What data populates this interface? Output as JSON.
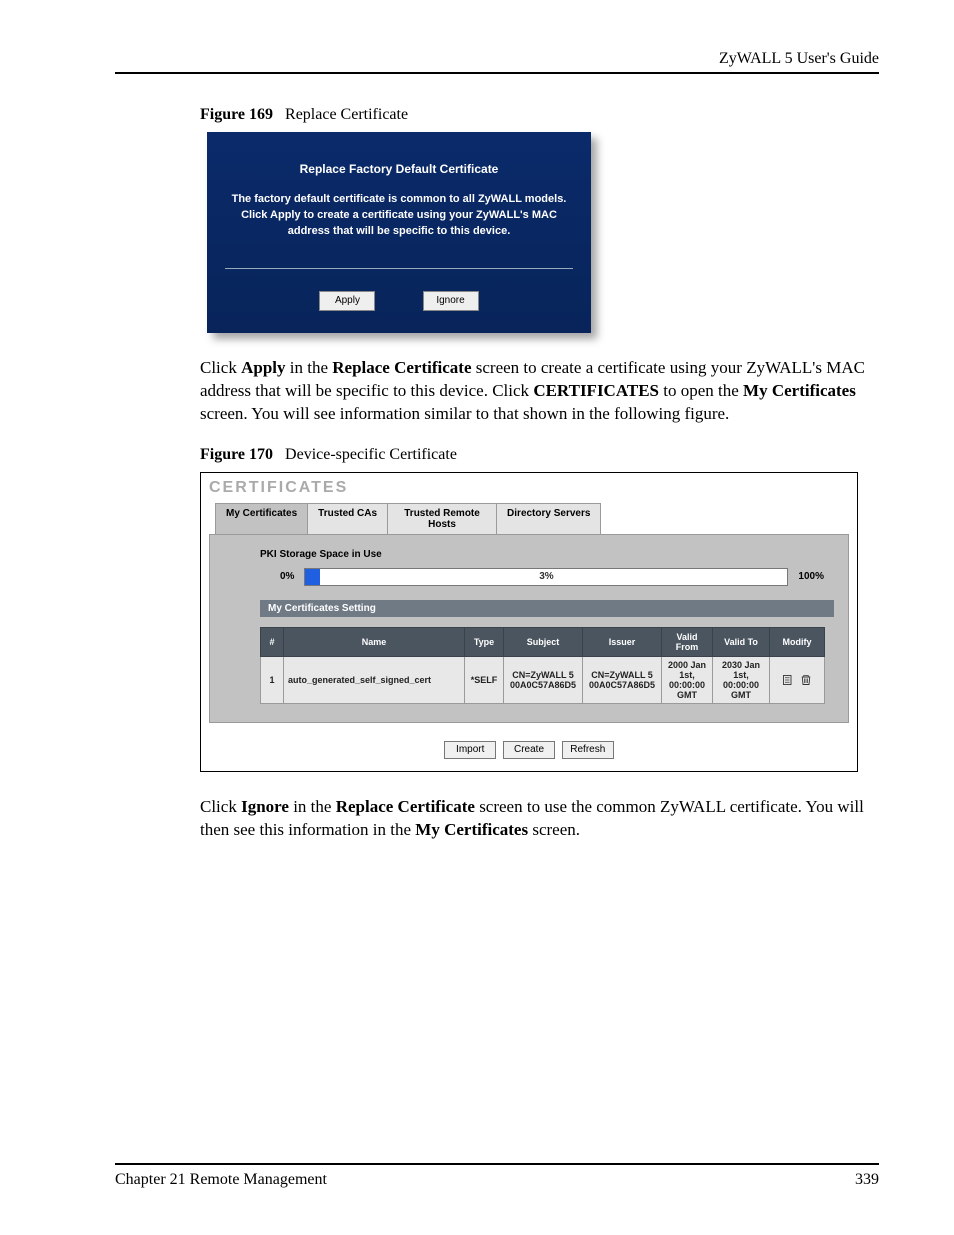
{
  "page_header": "ZyWALL 5 User's Guide",
  "figure169": {
    "label": "Figure 169",
    "title": "Replace Certificate",
    "dialog_title": "Replace Factory Default Certificate",
    "dialog_body": "The factory default certificate is common to all ZyWALL models. Click Apply to create a certificate using your ZyWALL's MAC address that will be specific to this device.",
    "apply_label": "Apply",
    "ignore_label": "Ignore"
  },
  "body_text_1_a": "Click ",
  "body_text_1_apply": "Apply",
  "body_text_1_b": " in the ",
  "body_text_1_replace": "Replace Certificate",
  "body_text_1_c": " screen to create a certificate using your ZyWALL's MAC address that will be specific to this device. Click ",
  "body_text_1_certs": "CERTIFICATES",
  "body_text_1_d": " to open the ",
  "body_text_1_my": "My Certificates",
  "body_text_1_e": " screen. You will see information similar to that shown in the following figure.",
  "figure170": {
    "label": "Figure 170",
    "title": "Device-specific Certificate",
    "screen_heading": "CERTIFICATES",
    "tabs": {
      "t0": "My Certificates",
      "t1": "Trusted CAs",
      "t2": "Trusted Remote Hosts",
      "t3": "Directory Servers"
    },
    "storage_label": "PKI Storage Space in Use",
    "storage_min": "0%",
    "storage_pct": "3%",
    "storage_max": "100%",
    "setting_label": "My Certificates Setting",
    "columns": {
      "num": "#",
      "name": "Name",
      "type": "Type",
      "subject": "Subject",
      "issuer": "Issuer",
      "valid_from": "Valid From",
      "valid_to": "Valid To",
      "modify": "Modify"
    },
    "row": {
      "num": "1",
      "name": "auto_generated_self_signed_cert",
      "type": "*SELF",
      "subject": "CN=ZyWALL 5 00A0C57A86D5",
      "issuer": "CN=ZyWALL 5 00A0C57A86D5",
      "valid_from": "2000 Jan 1st, 00:00:00 GMT",
      "valid_to": "2030 Jan 1st, 00:00:00 GMT"
    },
    "buttons": {
      "import": "Import",
      "create": "Create",
      "refresh": "Refresh"
    }
  },
  "body_text_2_a": "Click ",
  "body_text_2_ignore": "Ignore",
  "body_text_2_b": " in the ",
  "body_text_2_replace": "Replace Certificate",
  "body_text_2_c": " screen to use the common ZyWALL certificate. You will then see this information in the ",
  "body_text_2_my": "My Certificates",
  "body_text_2_d": " screen.",
  "footer_chapter": "Chapter 21 Remote Management",
  "footer_page": "339"
}
